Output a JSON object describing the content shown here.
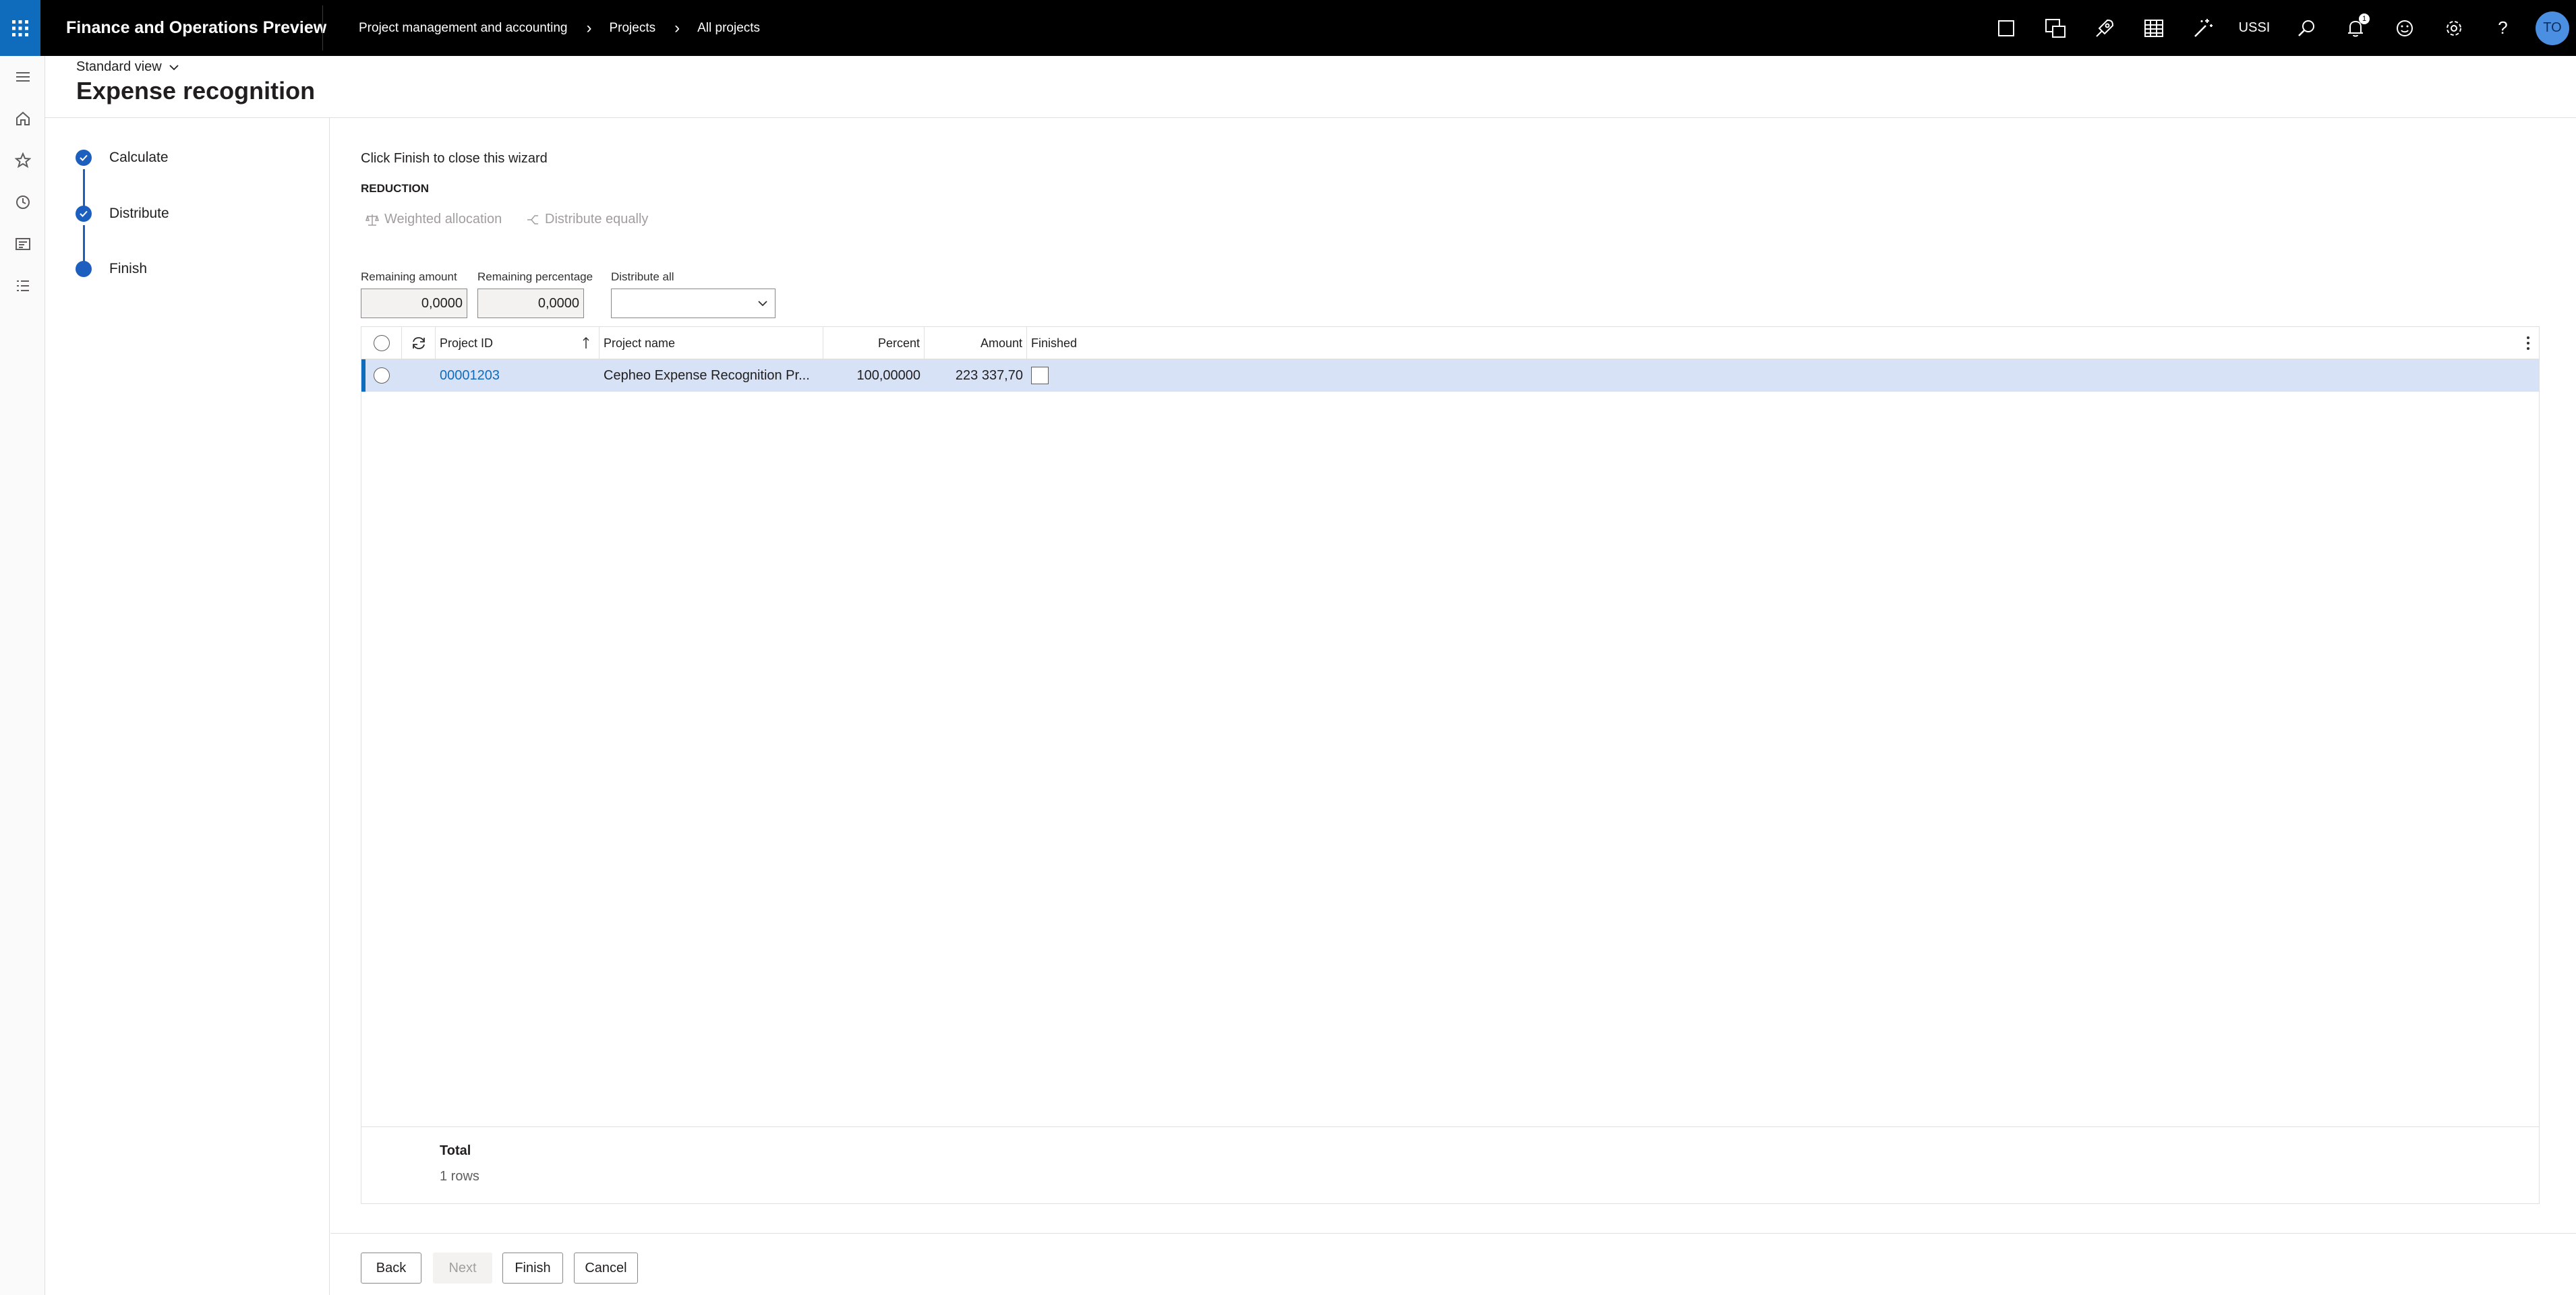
{
  "app": {
    "name": "Finance and Operations Preview",
    "breadcrumbs": [
      "Project management and accounting",
      "Projects",
      "All projects"
    ],
    "company": "USSI",
    "notification_count": "1",
    "user_initials": "TO"
  },
  "header": {
    "view": "Standard view",
    "title": "Expense recognition"
  },
  "wizard_steps": [
    {
      "label": "Calculate",
      "state": "completed"
    },
    {
      "label": "Distribute",
      "state": "completed"
    },
    {
      "label": "Finish",
      "state": "current"
    }
  ],
  "content": {
    "instruction": "Click Finish to close this wizard",
    "section_title": "REDUCTION",
    "actions": {
      "weighted_allocation": "Weighted allocation",
      "distribute_equally": "Distribute equally"
    },
    "fields": {
      "remaining_amount_label": "Remaining amount",
      "remaining_amount_value": "0,0000",
      "remaining_percentage_label": "Remaining percentage",
      "remaining_percentage_value": "0,0000",
      "distribute_all_label": "Distribute all",
      "distribute_all_value": ""
    }
  },
  "grid": {
    "columns": {
      "project_id": "Project ID",
      "project_name": "Project name",
      "percent": "Percent",
      "amount": "Amount",
      "finished": "Finished"
    },
    "rows": [
      {
        "project_id": "00001203",
        "project_name": "Cepheo Expense Recognition Pr...",
        "percent": "100,00000",
        "amount": "223 337,70",
        "finished": false
      }
    ],
    "footer": {
      "total_label": "Total",
      "rows_label": "1 rows"
    }
  },
  "buttons": {
    "back": "Back",
    "next": "Next",
    "finish": "Finish",
    "cancel": "Cancel"
  },
  "colors": {
    "accent": "#0f6cbd",
    "step": "#1c5fbf",
    "selected_row": "#d7e2f7",
    "topbar": "#000000"
  }
}
